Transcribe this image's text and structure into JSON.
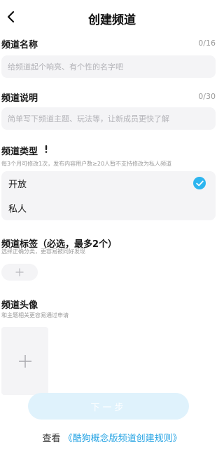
{
  "header": {
    "title": "创建频道"
  },
  "name_section": {
    "title": "频道名称",
    "counter": "0/16",
    "placeholder": "给频道起个响亮、有个性的名字吧"
  },
  "desc_section": {
    "title": "频道说明",
    "counter": "0/30",
    "placeholder": "简单写下频道主题、玩法等，让新成员更快了解"
  },
  "type_section": {
    "title": "频道类型",
    "hint": "每3个月可修改1次，发布内容用户数≥20人暂不支持修改为私人频道",
    "options": [
      {
        "label": "开放",
        "selected": true
      },
      {
        "label": "私人",
        "selected": false
      }
    ]
  },
  "tag_section": {
    "title": "频道标签（必选，最多2个）",
    "hint": "选择正确分类，更容易被同好发现"
  },
  "avatar_section": {
    "title": "频道头像",
    "hint": "和主题相关更容易通过申请"
  },
  "next_button": {
    "label": "下一步"
  },
  "footer": {
    "prefix": "查看",
    "link": "《酷狗概念版频道创建规则》"
  },
  "colors": {
    "accent": "#2db5ef",
    "link": "#2aa5e4",
    "input_bg": "#f4f4f6",
    "button_disabled": "#dff2fc"
  },
  "icons": {
    "back": "chevron-left-icon",
    "info": "exclamation-icon",
    "check": "check-icon",
    "plus": "plus-icon"
  }
}
